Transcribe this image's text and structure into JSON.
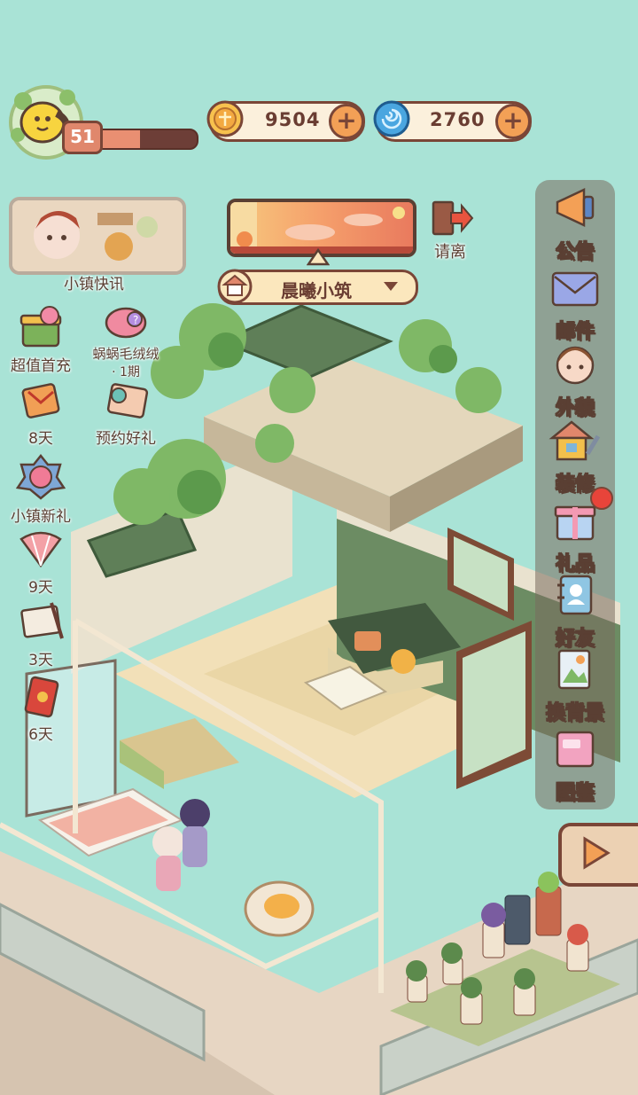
{
  "player": {
    "level": "51",
    "xp_fraction": 0.45
  },
  "currencies": [
    {
      "name": "coins",
      "icon": "coin-icon",
      "value": "9504"
    },
    {
      "name": "gems",
      "icon": "swirl-gem-icon",
      "value": "2760"
    }
  ],
  "left_menu": {
    "news_label": "小镇快讯",
    "items": [
      {
        "label": "超值首充",
        "icon": "gift-box-icon"
      },
      {
        "label": "蜗蜗毛绒绒",
        "sub": "· 1期",
        "icon": "plush-icon"
      },
      {
        "label": "8天",
        "icon": "envelope-icon"
      },
      {
        "label": "预约好礼",
        "icon": "ticket-icon"
      },
      {
        "label": "小镇新礼",
        "icon": "flower-badge-icon"
      },
      {
        "label": "9天",
        "icon": "fan-icon"
      },
      {
        "label": "3天",
        "icon": "letter-icon"
      },
      {
        "label": "6天",
        "icon": "red-envelope-icon"
      }
    ]
  },
  "house": {
    "name": "晨曦小筑",
    "leave_label": "请离"
  },
  "right_menu": [
    {
      "label": "公告",
      "icon": "megaphone-icon"
    },
    {
      "label": "邮件",
      "icon": "mail-icon"
    },
    {
      "label": "外貌",
      "icon": "character-face-icon"
    },
    {
      "label": "装修",
      "icon": "house-wrench-icon"
    },
    {
      "label": "礼品",
      "icon": "gift-icon"
    },
    {
      "label": "好友",
      "icon": "contact-book-icon"
    },
    {
      "label": "换背景",
      "icon": "background-icon"
    },
    {
      "label": "图鉴",
      "icon": "album-icon"
    }
  ],
  "colors": {
    "background": "#a9e3d6",
    "accent": "#f3a056",
    "outline": "#7a4637"
  }
}
